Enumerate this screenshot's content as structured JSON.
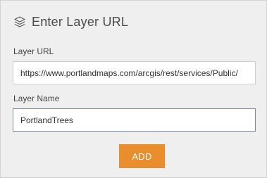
{
  "dialog": {
    "title": "Enter Layer URL",
    "title_icon": "layers-icon"
  },
  "layer_url": {
    "label": "Layer URL",
    "value": "https://www.portlandmaps.com/arcgis/rest/services/Public/"
  },
  "layer_name": {
    "label": "Layer Name",
    "value": "PortlandTrees"
  },
  "actions": {
    "add_label": "ADD"
  },
  "colors": {
    "panel_background": "#efefef",
    "add_button": "#ea8e2d",
    "focused_border": "#7d8aa6"
  }
}
